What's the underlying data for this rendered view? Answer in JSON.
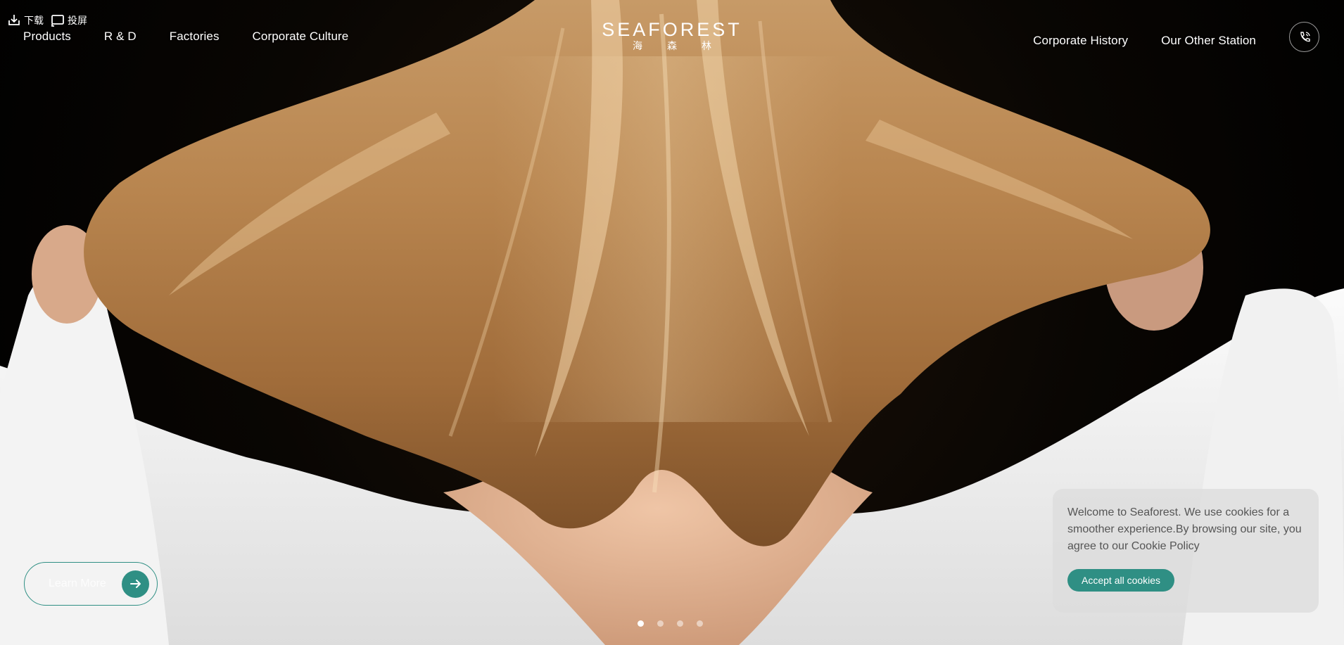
{
  "toolbar": {
    "download_label": "下载",
    "cast_label": "投屏"
  },
  "nav": {
    "left": [
      {
        "label": "Products"
      },
      {
        "label": "R & D"
      },
      {
        "label": "Factories"
      },
      {
        "label": "Corporate Culture"
      }
    ],
    "right": [
      {
        "label": "Corporate History"
      },
      {
        "label": "Our Other Station"
      }
    ]
  },
  "logo": {
    "main": "SEAFOREST",
    "sub": "海森林"
  },
  "hero": {
    "learn_more_label": "Learn More",
    "slides": 4,
    "active_slide": 1
  },
  "cookie": {
    "text": "Welcome to Seaforest. We use cookies for a smoother experience.By browsing our site, you agree to our Cookie Policy",
    "button_label": "Accept all cookies"
  },
  "icons": {
    "download": "download-icon",
    "cast": "cast-icon",
    "phone": "phone-icon",
    "arrow": "arrow-right-icon"
  },
  "colors": {
    "accent": "#2f8f84",
    "text_light": "#ffffff",
    "cookie_bg": "#dcdcdc"
  }
}
